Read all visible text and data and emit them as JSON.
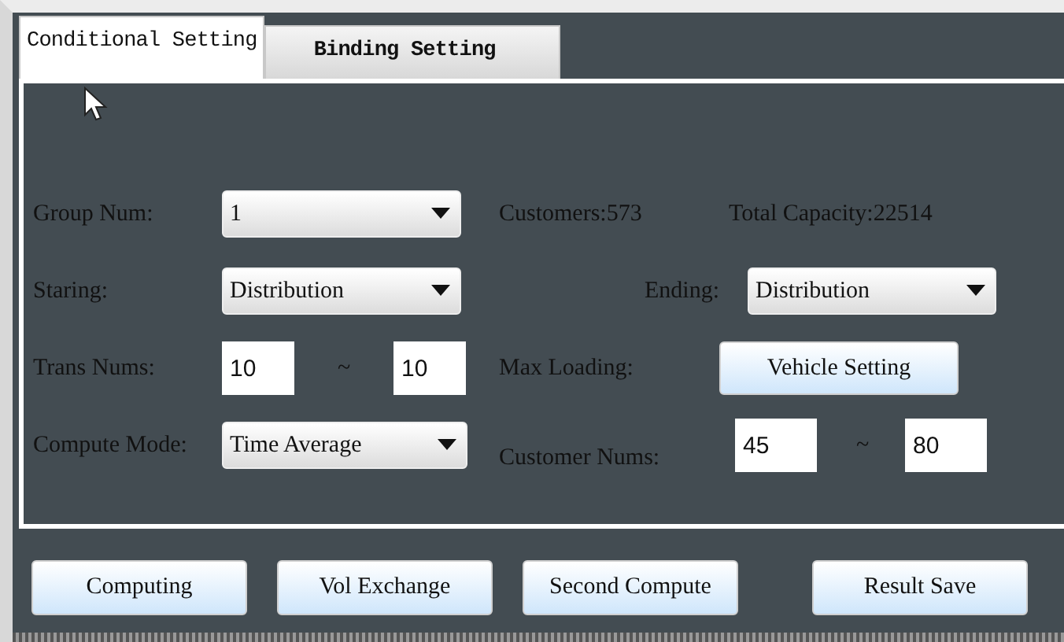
{
  "tabs": [
    {
      "label": "Conditional Setting",
      "selected": true
    },
    {
      "label": "Binding Setting",
      "selected": false
    }
  ],
  "form": {
    "group_num": {
      "label": "Group Num:",
      "value": "1"
    },
    "customers": "Customers:573",
    "total_capacity": "Total Capacity:22514",
    "staring": {
      "label": "Staring:",
      "value": "Distribution"
    },
    "ending": {
      "label": "Ending:",
      "value": "Distribution"
    },
    "trans_nums": {
      "label": "Trans Nums:",
      "min": "10",
      "separator": "~",
      "max": "10"
    },
    "max_loading": {
      "label": "Max Loading:",
      "button": "Vehicle Setting"
    },
    "compute_mode": {
      "label": "Compute Mode:",
      "value": "Time Average"
    },
    "customer_nums": {
      "label": "Customer Nums:",
      "min": "45",
      "separator": "~",
      "max": "80"
    }
  },
  "buttons": [
    "Computing",
    "Vol Exchange",
    "Second Compute",
    "Result Save"
  ]
}
